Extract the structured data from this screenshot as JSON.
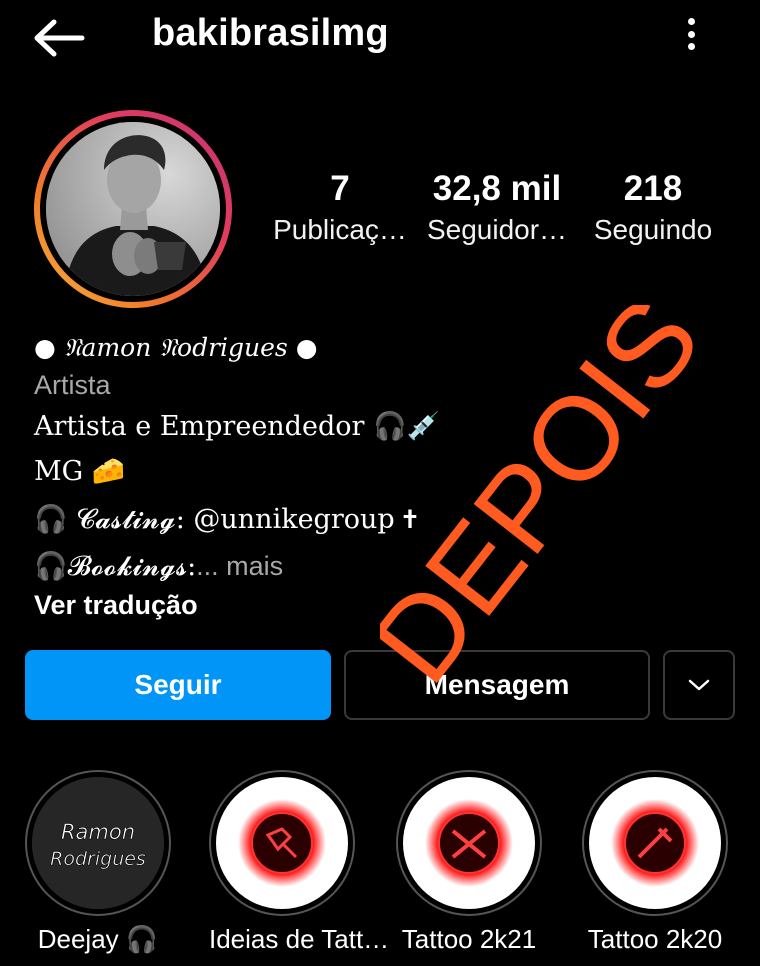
{
  "header": {
    "username": "bakibrasilmg",
    "back_icon": "arrow-left-icon",
    "menu_icon": "more-vertical-icon"
  },
  "stats": [
    {
      "value": "7",
      "label": "Publicaç…"
    },
    {
      "value": "32,8 mil",
      "label": "Seguidor…"
    },
    {
      "value": "218",
      "label": "Seguindo"
    }
  ],
  "bio": {
    "name": "● 𝔑amon 𝔑odrigues ●",
    "category": "Artista",
    "line1": "Artista e Empreendedor 🎧💉",
    "line2": "MG 🧀",
    "line3": "🎧 𝓒𝓪𝓼𝓽𝓲𝓷𝓰: @unnikegroup 🕇",
    "line4_prefix": "🎧𝓑𝓸𝓸𝓴𝓲𝓷𝓰𝓼:",
    "line4_more": "... mais",
    "translate": "Ver tradução"
  },
  "actions": {
    "follow": "Seguir",
    "message": "Mensagem",
    "more_icon": "chevron-down-icon"
  },
  "highlights": [
    {
      "label": "Deejay 🎧",
      "cover_text": "Ramon Rodrigues"
    },
    {
      "label": "Ideias de Tatt…"
    },
    {
      "label": "Tattoo 2k21"
    },
    {
      "label": "Tattoo 2k20"
    }
  ],
  "overlay": {
    "stamp_text": "DEPOIS",
    "color": "#ff5a1f"
  },
  "colors": {
    "accent": "#0095f6",
    "background": "#000000",
    "muted": "#a8a8a8"
  }
}
